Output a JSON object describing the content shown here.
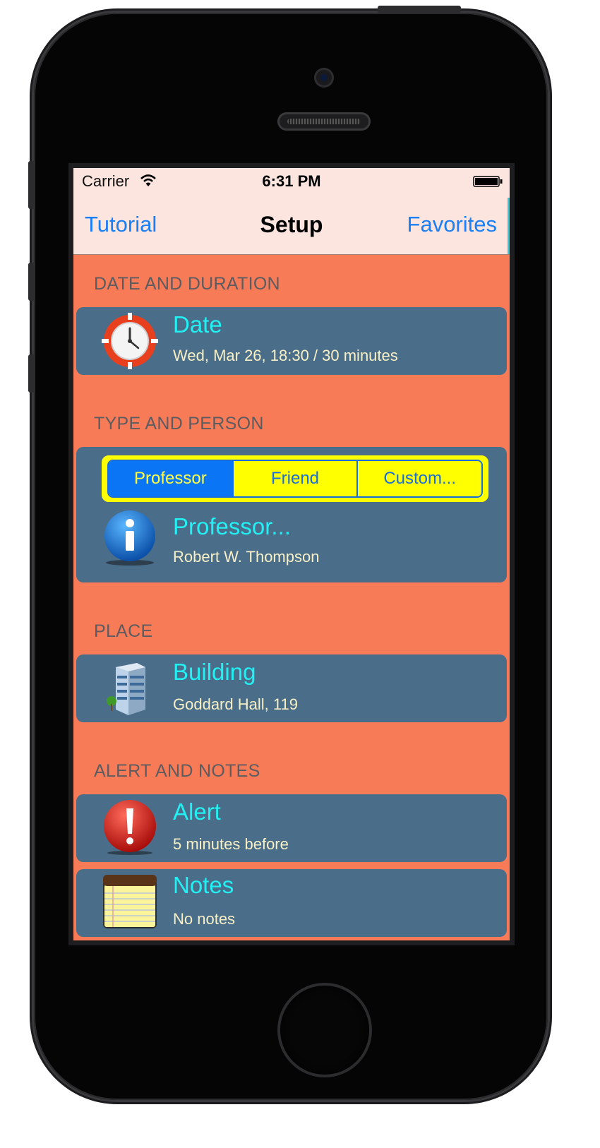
{
  "status_bar": {
    "carrier": "Carrier",
    "time": "6:31 PM"
  },
  "nav": {
    "left": "Tutorial",
    "title": "Setup",
    "right": "Favorites"
  },
  "sections": {
    "date": {
      "header": "DATE AND DURATION",
      "title": "Date",
      "subtitle": "Wed, Mar 26, 18:30 / 30 minutes",
      "icon": "clock-icon"
    },
    "type": {
      "header": "TYPE AND PERSON",
      "segments": [
        "Professor",
        "Friend",
        "Custom..."
      ],
      "selected_segment": "Professor",
      "title": "Professor...",
      "subtitle": "Robert W. Thompson",
      "icon": "info-icon"
    },
    "place": {
      "header": "PLACE",
      "title": "Building",
      "subtitle": "Goddard Hall, 119",
      "icon": "building-icon"
    },
    "alert": {
      "header": "ALERT AND NOTES",
      "title": "Alert",
      "subtitle": "5 minutes before",
      "icon": "alert-icon"
    },
    "notes": {
      "title": "Notes",
      "subtitle": "No notes",
      "icon": "notepad-icon"
    }
  },
  "colors": {
    "background": "#f87b58",
    "cell": "#4a6d89",
    "title_text": "#23f0f2",
    "subtitle_text": "#f7f0c6",
    "header_text": "#5c5c60",
    "nav_background": "#fde5df",
    "link": "#1a7ef5",
    "segment_background": "#ffff00",
    "segment_selected": "#0a76f5"
  }
}
